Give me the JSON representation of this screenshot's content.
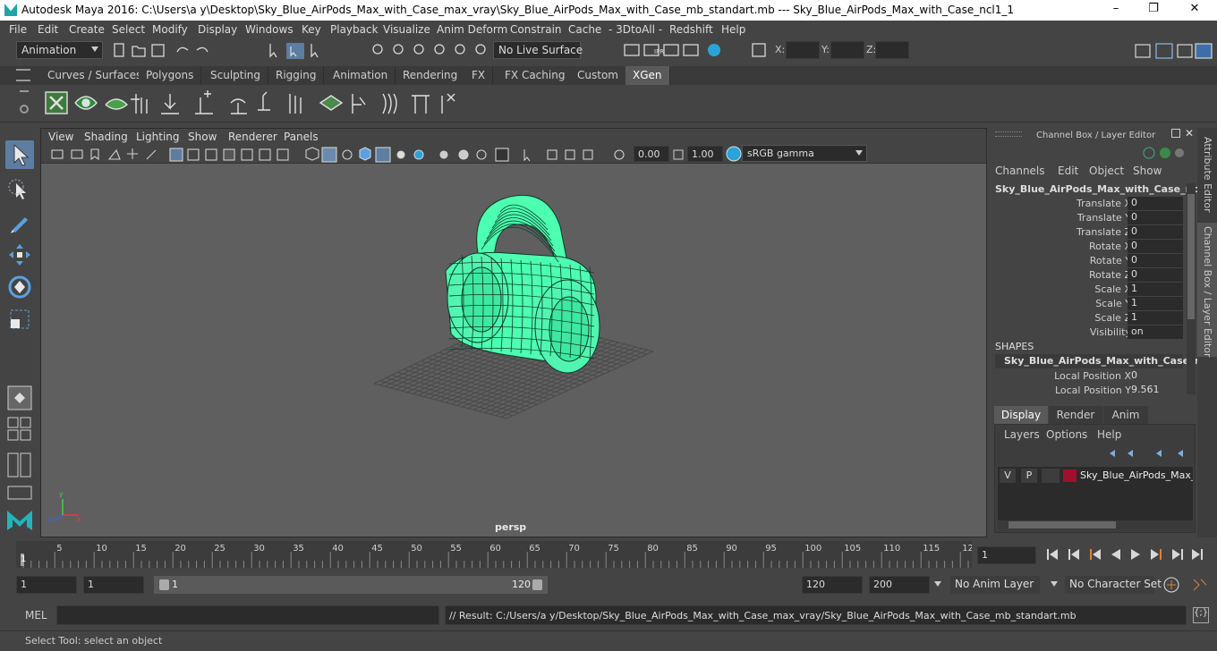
{
  "window": {
    "title": "Autodesk Maya 2016: C:\\Users\\a y\\Desktop\\Sky_Blue_AirPods_Max_with_Case_max_vray\\Sky_Blue_AirPods_Max_with_Case_mb_standart.mb   ---   Sky_Blue_AirPods_Max_with_Case_ncl1_1",
    "minimize": "–",
    "maximize": "❐",
    "close": "✕"
  },
  "menubar": [
    "File",
    "Edit",
    "Create",
    "Select",
    "Modify",
    "Display",
    "Windows",
    "Key",
    "Playback",
    "Visualize",
    "Anim Deform",
    "Constrain",
    "Cache",
    "- 3DtoAll -",
    "Redshift",
    "Help"
  ],
  "statusline": {
    "menu_set": "Animation",
    "live_surface": "No Live Surface",
    "x_label": "X:",
    "y_label": "Y:",
    "z_label": "Z:"
  },
  "shelf_tabs": [
    "Curves / Surfaces",
    "Polygons",
    "Sculpting",
    "Rigging",
    "Animation",
    "Rendering",
    "FX",
    "FX Caching",
    "Custom",
    "XGen"
  ],
  "shelf_active": "XGen",
  "panel_menu": [
    "View",
    "Shading",
    "Lighting",
    "Show",
    "Renderer",
    "Panels"
  ],
  "panel_toolbar": {
    "exposure": "0.00",
    "gamma": "1.00",
    "color_space": "sRGB gamma"
  },
  "viewport": {
    "camera": "persp",
    "axis_x": "x",
    "axis_y": "y",
    "axis_z": "z",
    "colors": {
      "wire": "#4dffb0",
      "grid": "#474747",
      "bg": "#5f5f5f"
    }
  },
  "channel_box": {
    "header": "Channel Box / Layer Editor",
    "menus": [
      "Channels",
      "Edit",
      "Object",
      "Show"
    ],
    "object_name": "Sky_Blue_AirPods_Max_with_Case_ncl...",
    "channels": [
      {
        "label": "Translate X",
        "value": "0"
      },
      {
        "label": "Translate Y",
        "value": "0"
      },
      {
        "label": "Translate Z",
        "value": "0"
      },
      {
        "label": "Rotate X",
        "value": "0"
      },
      {
        "label": "Rotate Y",
        "value": "0"
      },
      {
        "label": "Rotate Z",
        "value": "0"
      },
      {
        "label": "Scale X",
        "value": "1"
      },
      {
        "label": "Scale Y",
        "value": "1"
      },
      {
        "label": "Scale Z",
        "value": "1"
      },
      {
        "label": "Visibility",
        "value": "on"
      }
    ],
    "shapes_header": "SHAPES",
    "shape_name": "Sky_Blue_AirPods_Max_with_Case_n...",
    "shape_channels": [
      {
        "label": "Local Position X",
        "value": "0"
      },
      {
        "label": "Local Position Y",
        "value": "9.561"
      }
    ]
  },
  "layer_editor": {
    "tabs": [
      "Display",
      "Render",
      "Anim"
    ],
    "active_tab": "Display",
    "menus": [
      "Layers",
      "Options",
      "Help"
    ],
    "layer": {
      "v": "V",
      "p": "P",
      "name": "Sky_Blue_AirPods_Max_w",
      "color": "#a0102a"
    }
  },
  "side_tabs": [
    "Attribute Editor",
    "Channel Box / Layer Editor"
  ],
  "timeline": {
    "ticks": [
      "5",
      "10",
      "15",
      "20",
      "25",
      "30",
      "35",
      "40",
      "45",
      "50",
      "55",
      "60",
      "65",
      "70",
      "75",
      "80",
      "85",
      "90",
      "95",
      "100",
      "105",
      "110",
      "115",
      "12"
    ],
    "current_marker": "1",
    "current_frame": "1"
  },
  "range": {
    "start": "1",
    "playback_start": "1",
    "slider_start": "1",
    "slider_end": "120",
    "playback_end": "120",
    "end": "200",
    "anim_layer": "No Anim Layer",
    "character_set": "No Character Set"
  },
  "command": {
    "mel_label": "MEL",
    "result": "// Result: C:/Users/a y/Desktop/Sky_Blue_AirPods_Max_with_Case_max_vray/Sky_Blue_AirPods_Max_with_Case_mb_standart.mb"
  },
  "help_line": "Select Tool: select an object"
}
